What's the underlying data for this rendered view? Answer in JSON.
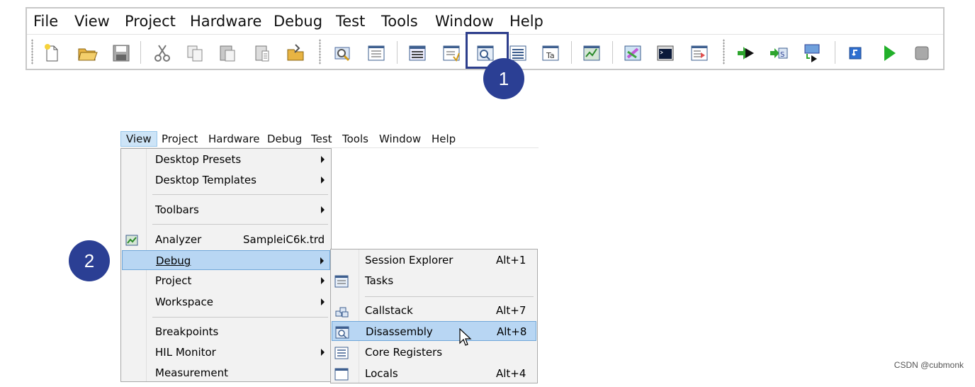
{
  "top_menu": [
    "File",
    "View",
    "Project",
    "Hardware",
    "Debug",
    "Test",
    "Tools",
    "Window",
    "Help"
  ],
  "toolbar_icons": [
    "new-file-icon",
    "open-folder-icon",
    "save-icon",
    "cut-icon",
    "copy-icon",
    "paste-icon",
    "paste-special-icon",
    "open-project-icon",
    "find-icon",
    "text-window-icon",
    "session-explorer-icon",
    "tasks-icon",
    "disassembly-icon",
    "core-registers-icon",
    "hierarchy-icon",
    "analyzer-icon",
    "measurement-icon",
    "console-icon",
    "edit-list-icon",
    "go-icon",
    "step-source-icon",
    "step-into-icon",
    "reset-icon",
    "run-icon",
    "stop-icon"
  ],
  "badges": {
    "one": "1",
    "two": "2"
  },
  "view_menu_bar": [
    "View",
    "Project",
    "Hardware",
    "Debug",
    "Test",
    "Tools",
    "Window",
    "Help"
  ],
  "view_menu": {
    "desktop_presets": "Desktop Presets",
    "desktop_templates": "Desktop Templates",
    "toolbars": "Toolbars",
    "analyzer": "Analyzer",
    "analyzer_file": "SampleiC6k.trd",
    "debug": "Debug",
    "project": "Project",
    "workspace": "Workspace",
    "breakpoints": "Breakpoints",
    "hil_monitor": "HIL Monitor",
    "measurement": "Measurement"
  },
  "debug_submenu": {
    "session_explorer": "Session Explorer",
    "session_explorer_sc": "Alt+1",
    "tasks": "Tasks",
    "callstack": "Callstack",
    "callstack_sc": "Alt+7",
    "disassembly": "Disassembly",
    "disassembly_sc": "Alt+8",
    "core_registers": "Core Registers",
    "locals": "Locals",
    "locals_sc": "Alt+4"
  },
  "watermark": "CSDN @cubmonk",
  "colors": {
    "badge": "#2b3f94",
    "selection": "#b8d6f3",
    "highlight_box": "#2d3e8c"
  }
}
